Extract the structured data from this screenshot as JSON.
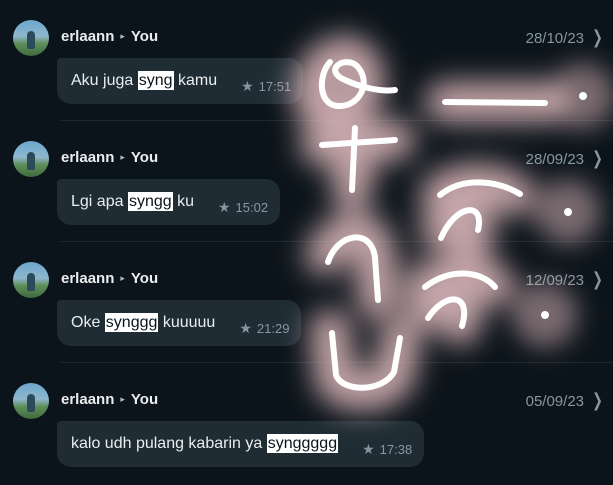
{
  "messages": [
    {
      "sender": "erlaann",
      "recipient": "You",
      "date": "28/10/23",
      "text_before": "Aku juga ",
      "highlight": "syng",
      "text_after": " kamu",
      "time": "17:51"
    },
    {
      "sender": "erlaann",
      "recipient": "You",
      "date": "28/09/23",
      "text_before": "Lgi apa ",
      "highlight": "syngg",
      "text_after": " ku",
      "time": "15:02"
    },
    {
      "sender": "erlaann",
      "recipient": "You",
      "date": "12/09/23",
      "text_before": "Oke ",
      "highlight": "synggg",
      "text_after": " kuuuuu",
      "time": "21:29"
    },
    {
      "sender": "erlaann",
      "recipient": "You",
      "date": "05/09/23",
      "text_before": "kalo udh pulang kabarin ya ",
      "highlight": "synggggg",
      "text_after": "",
      "time": "17:38"
    }
  ],
  "icons": {
    "arrow": "▸",
    "star": "★",
    "chevron": "❯"
  },
  "colors": {
    "background": "#0b141a",
    "bubble": "#1f2c34",
    "highlight": "#ffffff",
    "scribble_glow": "#f2c9cc"
  }
}
